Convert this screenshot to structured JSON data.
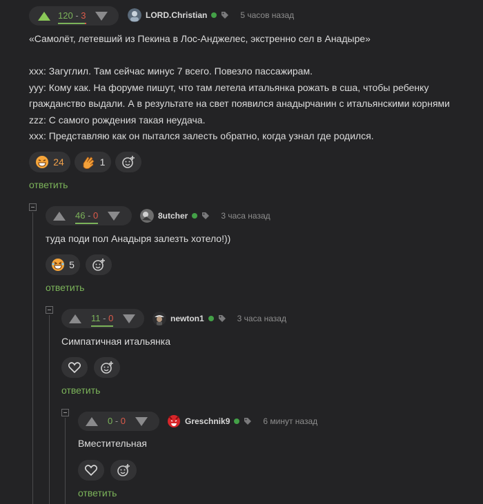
{
  "comments": [
    {
      "plus": "120",
      "sep": " - ",
      "minus": "3",
      "author": "LORD.Christian",
      "time": "5 часов назад",
      "lines": [
        "«Самолёт, летевший из Пекина в Лос-Анджелес, экстренно сел в Анадыре»",
        "",
        "xxx: Загуглил. Там сейчас минус 7 всего. Повезло пассажирам.",
        "yyy: Кому как. На форуме пишут, что там летела итальянка рожать в сша, чтобы ребенку",
        "гражданство выдали. А в результате на свет появился анадырчанин с итальянскими корнями",
        "zzz: С самого рождения такая неудача.",
        "xxx: Представляю как он пытался залесть обратно, когда узнал где родился."
      ],
      "reactions": [
        {
          "emoji": "grin-emoji",
          "count": "24"
        },
        {
          "emoji": "clap-emoji",
          "count": "1"
        }
      ],
      "reply": "ответить"
    },
    {
      "plus": "46",
      "sep": " - ",
      "minus": "0",
      "author": "8utcher",
      "time": "3 часа назад",
      "lines": [
        "туда поди пол Анадыря залезть хотело!))"
      ],
      "reactions": [
        {
          "emoji": "laugh-emoji",
          "count": "5"
        }
      ],
      "reply": "ответить"
    },
    {
      "plus": "11",
      "sep": " - ",
      "minus": "0",
      "author": "newton1",
      "time": "3 часа назад",
      "lines": [
        "Симпатичная итальянка"
      ],
      "reactions": [],
      "reply": "ответить"
    },
    {
      "plus": "0",
      "sep": " - ",
      "minus": "0",
      "author": "Greschnik9",
      "time": "6 минут назад",
      "lines": [
        "Вместительная"
      ],
      "reactions": [],
      "reply": "ответить"
    }
  ],
  "colors": {
    "accent": "#7cb45a",
    "minus": "#dc5a4a",
    "online": "#43a047"
  },
  "icons": {
    "up": "arrow-up-icon",
    "down": "arrow-down-icon",
    "add_reaction": "add-reaction-icon",
    "like": "heart-icon",
    "tag": "tag-icon"
  }
}
